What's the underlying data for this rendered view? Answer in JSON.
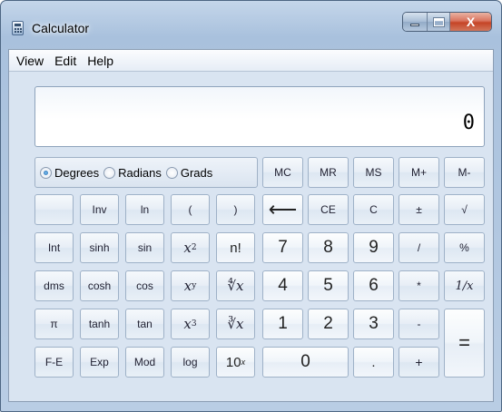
{
  "window": {
    "title": "Calculator",
    "close_glyph": "X"
  },
  "menu": [
    "View",
    "Edit",
    "Help"
  ],
  "display": {
    "value": "0"
  },
  "angle_modes": [
    {
      "label": "Degrees",
      "selected": true
    },
    {
      "label": "Radians",
      "selected": false
    },
    {
      "label": "Grads",
      "selected": false
    }
  ],
  "memory_keys": [
    "MC",
    "MR",
    "MS",
    "M+",
    "M-"
  ],
  "keys": {
    "blank": "",
    "inv": "Inv",
    "ln": "ln",
    "paren_open": "(",
    "paren_close": ")",
    "backspace": "⟵",
    "ce": "CE",
    "c": "C",
    "plus_minus": "±",
    "sqrt": "√",
    "int": "Int",
    "sinh": "sinh",
    "sin": "sin",
    "x_sq_base": "x",
    "x_sq_exp": "2",
    "factorial": "n!",
    "n7": "7",
    "n8": "8",
    "n9": "9",
    "divide": "/",
    "percent": "%",
    "dms": "dms",
    "cosh": "cosh",
    "cos": "cos",
    "x_y_base": "x",
    "x_y_exp": "y",
    "y_root": "∜x",
    "n4": "4",
    "n5": "5",
    "n6": "6",
    "multiply": "*",
    "reciprocal": "1/x",
    "pi": "π",
    "tanh": "tanh",
    "tan": "tan",
    "x_cube_base": "x",
    "x_cube_exp": "3",
    "cube_root": "∛x",
    "n1": "1",
    "n2": "2",
    "n3": "3",
    "minus": "-",
    "equals": "=",
    "fe": "F-E",
    "exp": "Exp",
    "mod": "Mod",
    "log": "log",
    "ten_base": "10",
    "ten_exp": "x",
    "n0": "0",
    "decimal": ".",
    "plus": "+"
  }
}
